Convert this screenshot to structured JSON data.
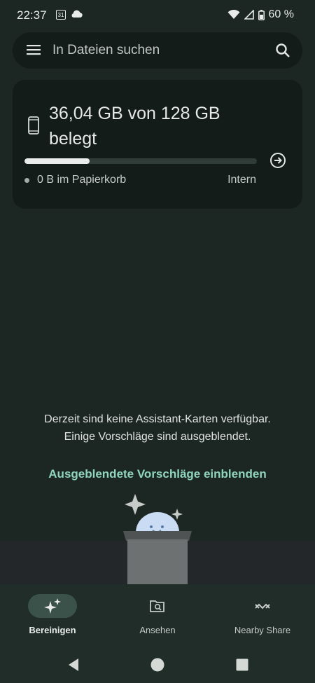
{
  "status_bar": {
    "time": "22:37",
    "calendar_day": "31",
    "battery": "60 %"
  },
  "search": {
    "placeholder": "In Dateien suchen"
  },
  "storage": {
    "title": "36,04 GB von 128 GB belegt",
    "used_fraction": 0.28,
    "trash_label": "0 B im Papierkorb",
    "location_label": "Intern"
  },
  "empty_state": {
    "line1": "Derzeit sind keine Assistant-Karten verfügbar.",
    "line2": "Einige Vorschläge sind ausgeblendet.",
    "link": "Ausgeblendete Vorschläge einblenden"
  },
  "bottom_nav": {
    "items": [
      {
        "label": "Bereinigen",
        "icon": "sparkle-icon",
        "active": true
      },
      {
        "label": "Ansehen",
        "icon": "browse-icon",
        "active": false
      },
      {
        "label": "Nearby Share",
        "icon": "nearby-share-icon",
        "active": false
      }
    ]
  },
  "colors": {
    "background": "#1c2723",
    "card": "#141c19",
    "accent_link": "#8fd4bd",
    "active_pill": "#3b524a"
  }
}
